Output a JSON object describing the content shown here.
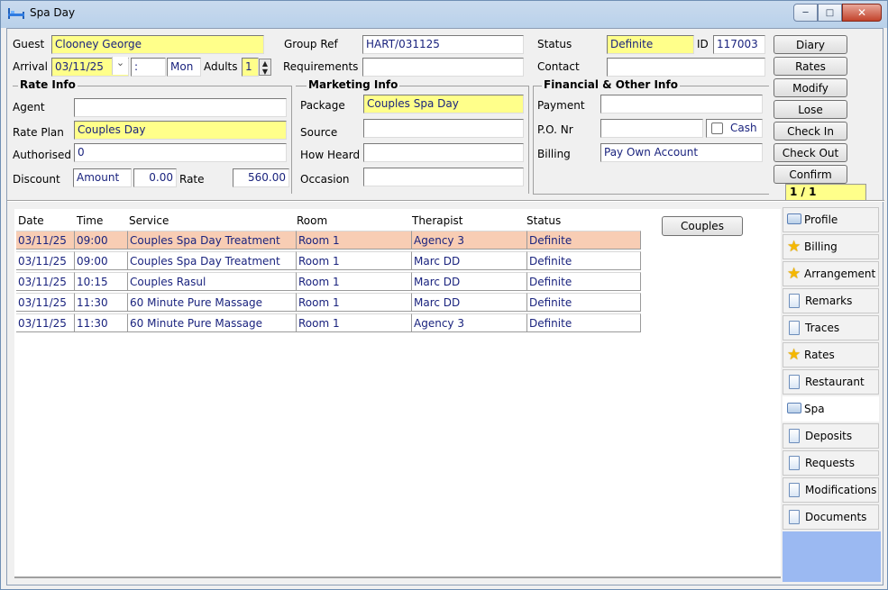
{
  "window": {
    "title": "Spa Day"
  },
  "header": {
    "guest_label": "Guest",
    "guest": "Clooney George",
    "group_ref_label": "Group Ref",
    "group_ref": "HART/031125",
    "status_label": "Status",
    "status": "Definite",
    "id_label": "ID",
    "id": "117003",
    "arrival_label": "Arrival",
    "arrival_date": "03/11/25",
    "arrival_time": ":",
    "arrival_day": "Mon",
    "adults_label": "Adults",
    "adults": "1",
    "requirements_label": "Requirements",
    "requirements": "",
    "contact_label": "Contact",
    "contact": ""
  },
  "rate_info": {
    "title": "Rate Info",
    "agent_label": "Agent",
    "agent": "",
    "rate_plan_label": "Rate Plan",
    "rate_plan": "Couples Day",
    "authorised_label": "Authorised",
    "authorised": "0",
    "discount_label": "Discount",
    "discount_type": "Amount",
    "discount_value": "0.00",
    "rate_label": "Rate",
    "rate": "560.00"
  },
  "marketing_info": {
    "title": "Marketing Info",
    "package_label": "Package",
    "package": "Couples Spa Day",
    "source_label": "Source",
    "source": "",
    "how_heard_label": "How Heard",
    "how_heard": "",
    "occasion_label": "Occasion",
    "occasion": ""
  },
  "financial_info": {
    "title": "Financial & Other Info",
    "payment_label": "Payment",
    "payment": "",
    "po_label": "P.O. Nr",
    "po": "",
    "cash_label": "Cash",
    "billing_label": "Billing",
    "billing": "Pay Own Account"
  },
  "actions": {
    "diary": "Diary",
    "rates": "Rates",
    "modify": "Modify",
    "lose": "Lose",
    "check_in": "Check In",
    "check_out": "Check Out",
    "confirm": "Confirm",
    "pager": "1 / 1"
  },
  "grid": {
    "columns": [
      "Date",
      "Time",
      "Service",
      "Room",
      "Therapist",
      "Status"
    ],
    "rows": [
      [
        "03/11/25",
        "09:00",
        "Couples Spa Day Treatment",
        "Room 1",
        "Agency 3",
        "Definite"
      ],
      [
        "03/11/25",
        "09:00",
        "Couples Spa Day Treatment",
        "Room 1",
        "Marc DD",
        "Definite"
      ],
      [
        "03/11/25",
        "10:15",
        "Couples Rasul",
        "Room 1",
        "Marc DD",
        "Definite"
      ],
      [
        "03/11/25",
        "11:30",
        "60 Minute Pure Massage",
        "Room 1",
        "Marc DD",
        "Definite"
      ],
      [
        "03/11/25",
        "11:30",
        "60 Minute Pure Massage",
        "Room 1",
        "Agency 3",
        "Definite"
      ]
    ],
    "couples_button": "Couples"
  },
  "tabs": [
    {
      "label": "Profile",
      "icon": "chat-icon"
    },
    {
      "label": "Billing",
      "icon": "star-icon"
    },
    {
      "label": "Arrangement",
      "icon": "star-icon"
    },
    {
      "label": "Remarks",
      "icon": "document-icon"
    },
    {
      "label": "Traces",
      "icon": "document-icon"
    },
    {
      "label": "Rates",
      "icon": "star-icon"
    },
    {
      "label": "Restaurant",
      "icon": "document-icon"
    },
    {
      "label": "Spa",
      "icon": "chat-icon"
    },
    {
      "label": "Deposits",
      "icon": "document-icon"
    },
    {
      "label": "Requests",
      "icon": "document-icon"
    },
    {
      "label": "Modifications",
      "icon": "document-icon"
    },
    {
      "label": "Documents",
      "icon": "document-icon"
    }
  ],
  "colors": {
    "field_highlight": "#ffff8a",
    "selected_row": "#f8cdb4",
    "value_text": "#1a237e"
  }
}
